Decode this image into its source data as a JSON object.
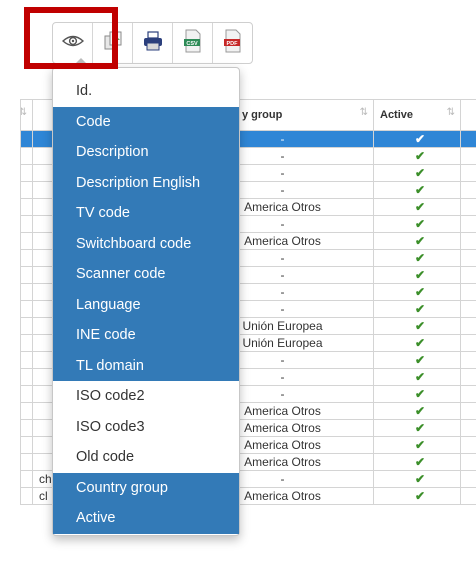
{
  "toolbar": {
    "buttons": [
      {
        "name": "column-visibility",
        "icon": "eye-icon"
      },
      {
        "name": "copy",
        "icon": "copy-icon"
      },
      {
        "name": "print",
        "icon": "printer-icon"
      },
      {
        "name": "csv",
        "icon": "csv-file-icon",
        "label": "CSV"
      },
      {
        "name": "pdf",
        "icon": "pdf-file-icon",
        "label": "PDF"
      }
    ]
  },
  "colors": {
    "accent": "#337ab7",
    "highlight_frame": "#c00000",
    "check": "#3c8f2a",
    "selected_row": "#2f86d6"
  },
  "table": {
    "headers": {
      "group": "y group",
      "active": "Active"
    },
    "rows": [
      {
        "code": "",
        "group": "-",
        "active": "✔"
      },
      {
        "code": "",
        "group": "-",
        "active": "✔"
      },
      {
        "code": "",
        "group": "-",
        "active": "✔"
      },
      {
        "code": "",
        "group": "-",
        "active": "✔"
      },
      {
        "code": "",
        "group": "America Otros",
        "active": "✔"
      },
      {
        "code": "",
        "group": "-",
        "active": "✔"
      },
      {
        "code": "",
        "group": "America Otros",
        "active": "✔"
      },
      {
        "code": "",
        "group": "-",
        "active": "✔"
      },
      {
        "code": "",
        "group": "-",
        "active": "✔"
      },
      {
        "code": "",
        "group": "-",
        "active": "✔"
      },
      {
        "code": "",
        "group": "-",
        "active": "✔"
      },
      {
        "code": "",
        "group": "Unión Europea",
        "active": "✔"
      },
      {
        "code": "",
        "group": "Unión Europea",
        "active": "✔"
      },
      {
        "code": "",
        "group": "-",
        "active": "✔"
      },
      {
        "code": "",
        "group": "-",
        "active": "✔"
      },
      {
        "code": "",
        "group": "-",
        "active": "✔"
      },
      {
        "code": "",
        "group": "America Otros",
        "active": "✔"
      },
      {
        "code": "",
        "group": "America Otros",
        "active": "✔"
      },
      {
        "code": "",
        "group": "America Otros",
        "active": "✔"
      },
      {
        "code": "",
        "group": "America Otros",
        "active": "✔"
      },
      {
        "code": "ch",
        "group": "-",
        "active": "✔"
      },
      {
        "code": "cl",
        "group": "America Otros",
        "active": "✔"
      }
    ]
  },
  "dropdown": {
    "items": [
      {
        "label": "Id.",
        "active": false
      },
      {
        "label": "Code",
        "active": true
      },
      {
        "label": "Description",
        "active": true
      },
      {
        "label": "Description English",
        "active": true
      },
      {
        "label": "TV code",
        "active": true
      },
      {
        "label": "Switchboard code",
        "active": true
      },
      {
        "label": "Scanner code",
        "active": true
      },
      {
        "label": "Language",
        "active": true
      },
      {
        "label": "INE code",
        "active": true
      },
      {
        "label": "TL domain",
        "active": true
      },
      {
        "label": "ISO code2",
        "active": false
      },
      {
        "label": "ISO code3",
        "active": false
      },
      {
        "label": "Old code",
        "active": false
      },
      {
        "label": "Country group",
        "active": true
      },
      {
        "label": "Active",
        "active": true
      }
    ]
  }
}
